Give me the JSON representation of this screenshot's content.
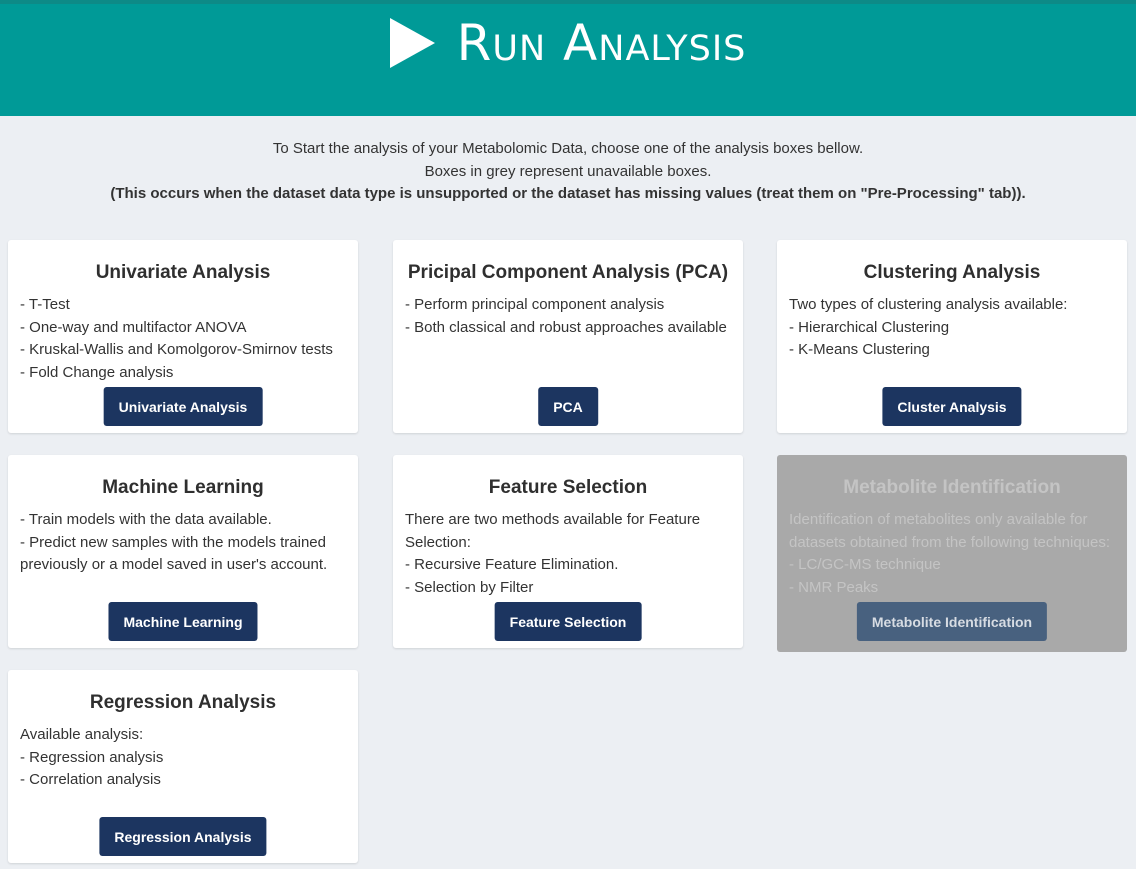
{
  "header": {
    "title": "Run Analysis"
  },
  "intro": {
    "line1": "To Start the analysis of your Metabolomic Data, choose one of the analysis boxes bellow.",
    "line2": "Boxes in grey represent unavailable boxes.",
    "line3": "(This occurs when the dataset data type is unsupported or the dataset has missing values (treat them on \"Pre-Processing\" tab))."
  },
  "cards": [
    {
      "title": "Univariate Analysis",
      "lines": [
        "- T-Test",
        "- One-way and multifactor ANOVA",
        "- Kruskal-Wallis and Komolgorov-Smirnov tests",
        "- Fold Change analysis"
      ],
      "button": "Univariate Analysis",
      "enabled": true
    },
    {
      "title": "Pricipal Component Analysis (PCA)",
      "lines": [
        "- Perform principal component analysis",
        "- Both classical and robust approaches available"
      ],
      "button": "PCA",
      "enabled": true
    },
    {
      "title": "Clustering Analysis",
      "lines": [
        "Two types of clustering analysis available:",
        "- Hierarchical Clustering",
        "- K-Means Clustering"
      ],
      "button": "Cluster Analysis",
      "enabled": true
    },
    {
      "title": "Machine Learning",
      "lines": [
        "- Train models with the data available.",
        "- Predict new samples with the models trained",
        "previously or a model saved in user's account."
      ],
      "button": "Machine Learning",
      "enabled": true
    },
    {
      "title": "Feature Selection",
      "lines": [
        "There are two methods available for Feature",
        "Selection:",
        "- Recursive Feature Elimination.",
        "- Selection by Filter"
      ],
      "button": "Feature Selection",
      "enabled": true
    },
    {
      "title": "Metabolite Identification",
      "lines": [
        "Identification of metabolites only available for",
        "datasets obtained from the following techniques:",
        "- LC/GC-MS technique",
        "- NMR Peaks"
      ],
      "button": "Metabolite Identification",
      "enabled": false
    },
    {
      "title": "Regression Analysis",
      "lines": [
        "Available analysis:",
        "- Regression analysis",
        "- Correlation analysis"
      ],
      "button": "Regression Analysis",
      "enabled": true
    }
  ]
}
